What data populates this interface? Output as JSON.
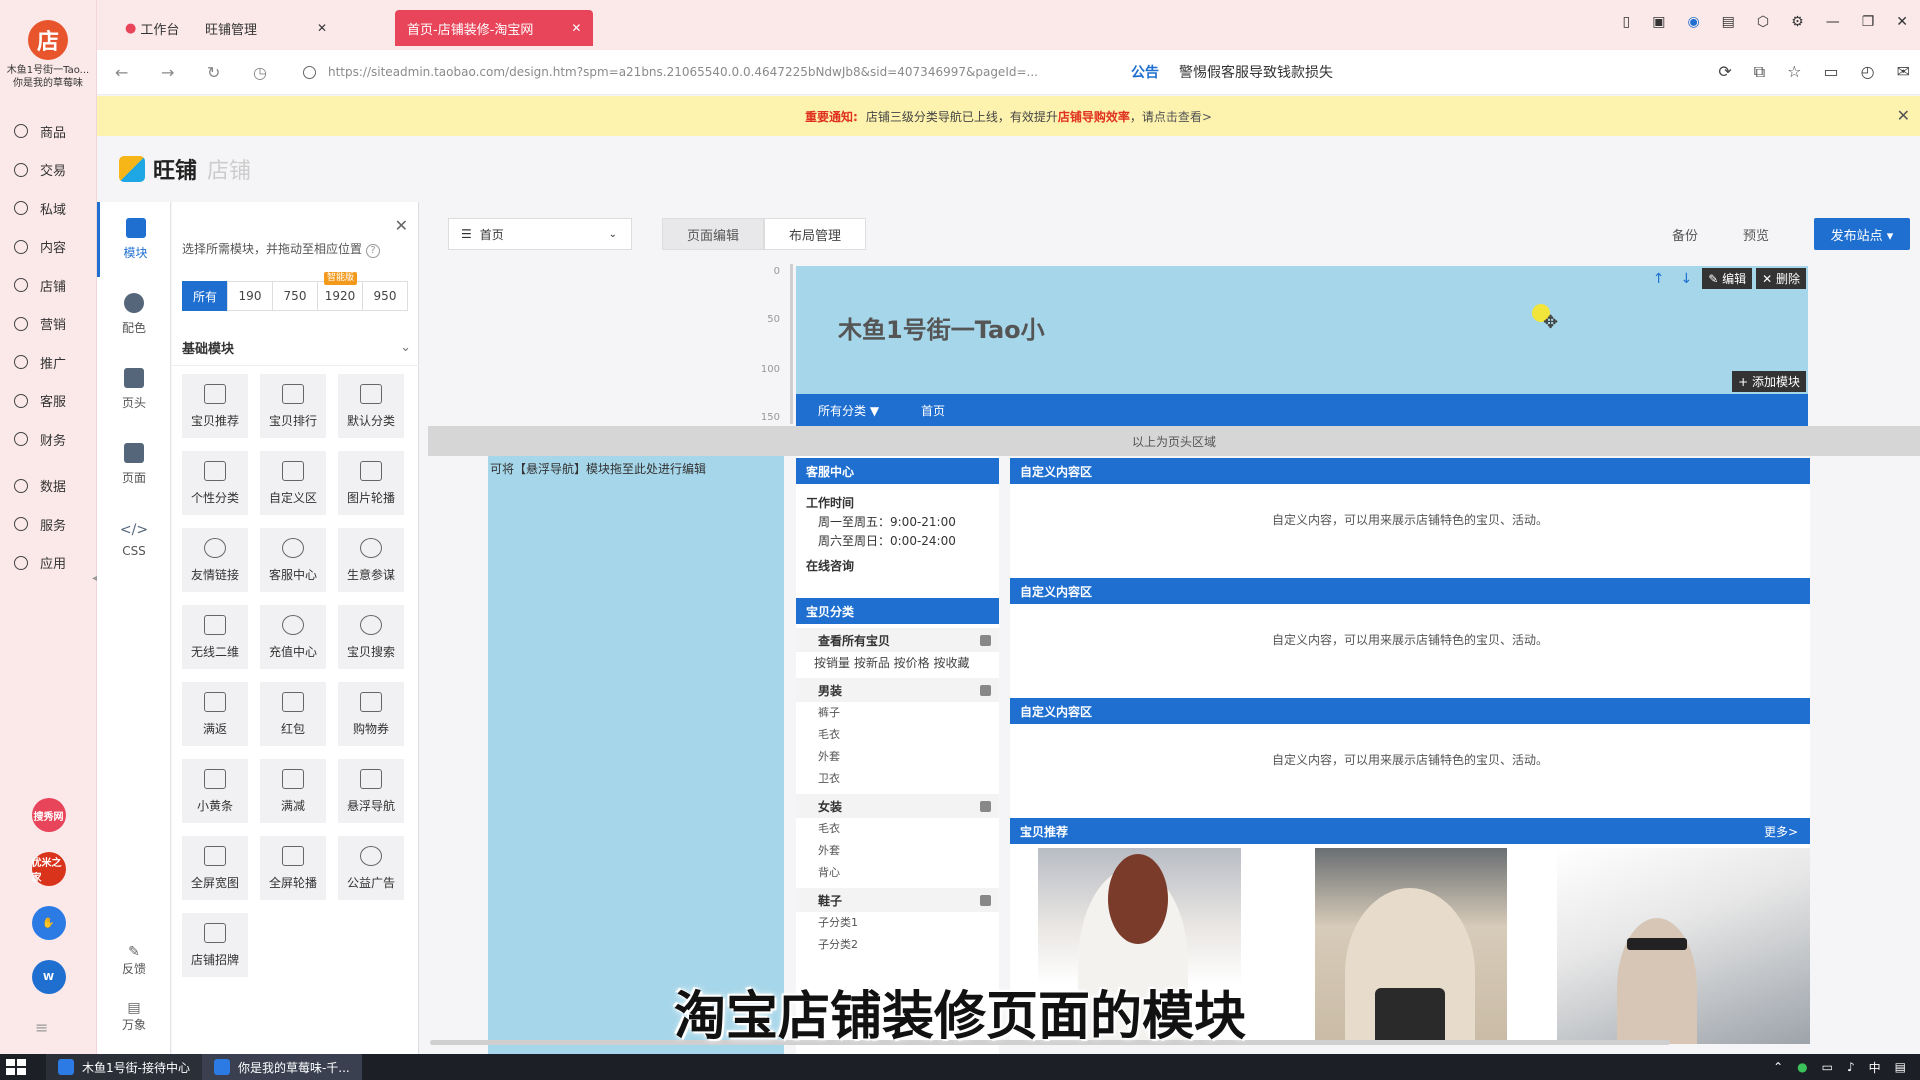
{
  "app": {
    "logo_char": "店",
    "user_name": "木鱼1号街一Tao... 你是我的草莓味",
    "nav": [
      "商品",
      "交易",
      "私域",
      "内容",
      "店铺",
      "营销",
      "推广",
      "客服",
      "财务",
      "数据",
      "服务",
      "应用"
    ],
    "apps": [
      {
        "label": "搜秀网",
        "color": "#e8445a"
      },
      {
        "label": "优米之家",
        "color": "#d9331c"
      },
      {
        "label": "",
        "color": "#2c7be5"
      },
      {
        "label": "W",
        "color": "#1f6fd1"
      }
    ]
  },
  "browser": {
    "tabs": [
      {
        "label": "工作台"
      },
      {
        "label": "旺铺管理"
      },
      {
        "label": "首页-店铺装修-淘宝网",
        "active": true
      }
    ],
    "url": "https://siteadmin.taobao.com/design.htm?spm=a21bns.21065540.0.0.4647225bNdwJb8&sid=407346997&pageId=...",
    "notice_title": "公告",
    "notice_text": "警惕假客服导致钱款损失"
  },
  "alert": {
    "prefix": "重要通知:",
    "text_before": "店铺三级分类导航已上线，有效提升",
    "highlight": "店铺导购效率",
    "text_after": "，请",
    "link": "点击查看>"
  },
  "header": {
    "brand": "旺铺",
    "sub": "店铺"
  },
  "edit_col": {
    "items": [
      {
        "label": "模块",
        "active": true
      },
      {
        "label": "配色"
      },
      {
        "label": "页头"
      },
      {
        "label": "页面"
      },
      {
        "label": "CSS",
        "code": "</>"
      }
    ],
    "bottom": [
      "反馈",
      "万象"
    ]
  },
  "module_panel": {
    "hint": "选择所需模块，并拖动至相应位置",
    "help": "?",
    "close": "✕",
    "filters": [
      "所有",
      "190",
      "750",
      "1920",
      "950"
    ],
    "badge": "智能版",
    "section": "基础模块",
    "tiles": [
      "宝贝推荐",
      "宝贝排行",
      "默认分类",
      "个性分类",
      "自定义区",
      "图片轮播",
      "友情链接",
      "客服中心",
      "生意参谋",
      "无线二维",
      "充值中心",
      "宝贝搜索",
      "满返",
      "红包",
      "购物券",
      "小黄条",
      "满减",
      "悬浮导航",
      "全屏宽图",
      "全屏轮播",
      "公益广告",
      "店铺招牌"
    ]
  },
  "toolbar": {
    "page": "首页",
    "segments": [
      "页面编辑",
      "布局管理"
    ],
    "backup": "备份",
    "preview": "预览",
    "publish": "发布站点 ▾"
  },
  "ruler": [
    "0",
    "50",
    "100",
    "150"
  ],
  "shop_header": {
    "name": "木鱼1号街一Tao小",
    "edit": "✎ 编辑",
    "delete": "✕ 删除",
    "add": "+ 添加模块"
  },
  "shop_nav": [
    "所有分类 ▼",
    "首页"
  ],
  "divider": "以上为页头区域",
  "float_zone": "可将【悬浮导航】模块拖至此处进行编辑",
  "service": {
    "title": "客服中心",
    "hours_label": "工作时间",
    "weekday": "周一至周五：9:00-21:00",
    "weekend": "周六至周日：0:00-24:00",
    "online": "在线咨询"
  },
  "categories": {
    "title": "宝贝分类",
    "all": "查看所有宝贝",
    "sort": "按销量 按新品 按价格 按收藏",
    "groups": [
      {
        "name": "男装",
        "subs": [
          "裤子",
          "毛衣",
          "外套",
          "卫衣"
        ]
      },
      {
        "name": "女装",
        "subs": [
          "毛衣",
          "外套",
          "背心"
        ]
      },
      {
        "name": "鞋子",
        "subs": [
          "子分类1",
          "子分类2"
        ]
      }
    ]
  },
  "custom_areas": [
    {
      "title": "自定义内容区",
      "body": "自定义内容，可以用来展示店铺特色的宝贝、活动。"
    },
    {
      "title": "自定义内容区",
      "body": "自定义内容，可以用来展示店铺特色的宝贝、活动。"
    },
    {
      "title": "自定义内容区",
      "body": "自定义内容，可以用来展示店铺特色的宝贝、活动。"
    }
  ],
  "recommend": {
    "title": "宝贝推荐",
    "more": "更多>"
  },
  "subtitle": "淘宝店铺装修页面的模块",
  "taskbar": {
    "tasks": [
      "木鱼1号街-接待中心",
      "你是我的草莓味-千..."
    ]
  }
}
